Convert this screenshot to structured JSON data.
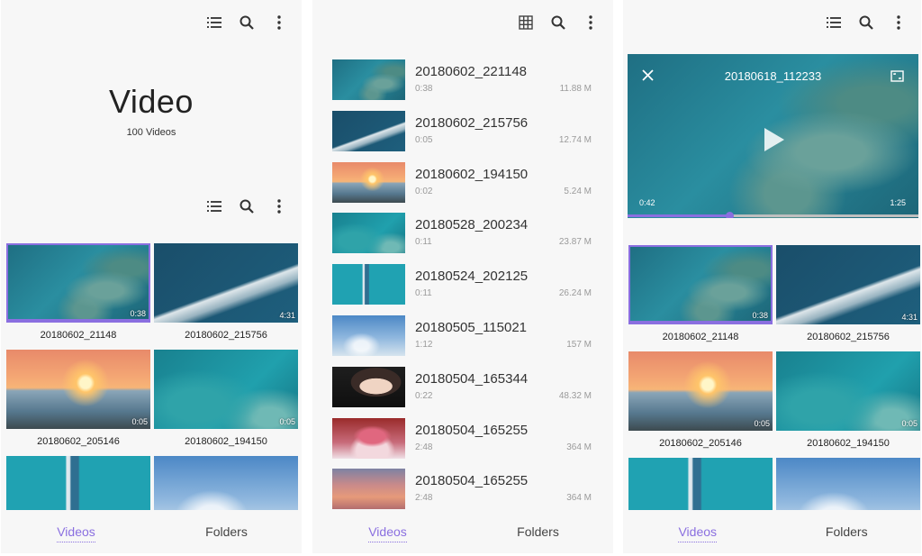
{
  "colors": {
    "accent": "#8a6fe0",
    "panel_bg": "#f7f7f7"
  },
  "icons": {
    "list_view": "list-view-icon",
    "grid_view": "grid-view-icon",
    "search": "search-icon",
    "more": "more-vertical-icon",
    "close": "close-icon",
    "fullscreen": "fullscreen-icon",
    "play": "play-icon"
  },
  "tabs": {
    "videos": "Videos",
    "folders": "Folders"
  },
  "panel1": {
    "title": "Video",
    "subtitle": "100 Videos",
    "videos": [
      {
        "name": "20180602_21148",
        "duration": "0:38",
        "thumb": "reef"
      },
      {
        "name": "20180602_215756",
        "duration": "4:31",
        "thumb": "wake"
      },
      {
        "name": "20180602_205146",
        "duration": "0:05",
        "thumb": "sunset"
      },
      {
        "name": "20180602_194150",
        "duration": "0:05",
        "thumb": "coast"
      },
      {
        "name": "",
        "duration": "",
        "thumb": "pier"
      },
      {
        "name": "",
        "duration": "",
        "thumb": "sky"
      }
    ]
  },
  "panel2": {
    "rows": [
      {
        "title": "20180602_221148",
        "duration": "0:38",
        "size": "11.88 M",
        "thumb": "reef"
      },
      {
        "title": "20180602_215756",
        "duration": "0:05",
        "size": "12.74  M",
        "thumb": "wake"
      },
      {
        "title": "20180602_194150",
        "duration": "0:02",
        "size": "5.24 M",
        "thumb": "sunset"
      },
      {
        "title": "20180528_200234",
        "duration": "0:11",
        "size": "23.87 M",
        "thumb": "coast"
      },
      {
        "title": "20180524_202125",
        "duration": "0:11",
        "size": "26.24 M",
        "thumb": "pier"
      },
      {
        "title": "20180505_115021",
        "duration": "1:12",
        "size": "157 M",
        "thumb": "sky"
      },
      {
        "title": "20180504_165344",
        "duration": "0:22",
        "size": "48.32 M",
        "thumb": "portrait"
      },
      {
        "title": "20180504_165255",
        "duration": "2:48",
        "size": "364 M",
        "thumb": "cake"
      },
      {
        "title": "20180504_165255",
        "duration": "2:48",
        "size": "364 M",
        "thumb": "dusk"
      }
    ]
  },
  "panel3": {
    "player": {
      "title": "20180618_112233",
      "current": "0:42",
      "total": "1:25",
      "progress": 0.35
    },
    "videos": [
      {
        "name": "20180602_21148",
        "duration": "0:38",
        "thumb": "reef"
      },
      {
        "name": "20180602_215756",
        "duration": "4:31",
        "thumb": "wake"
      },
      {
        "name": "20180602_205146",
        "duration": "0:05",
        "thumb": "sunset"
      },
      {
        "name": "20180602_194150",
        "duration": "0:05",
        "thumb": "coast"
      },
      {
        "name": "",
        "duration": "",
        "thumb": "pier"
      },
      {
        "name": "",
        "duration": "",
        "thumb": "sky"
      }
    ]
  }
}
